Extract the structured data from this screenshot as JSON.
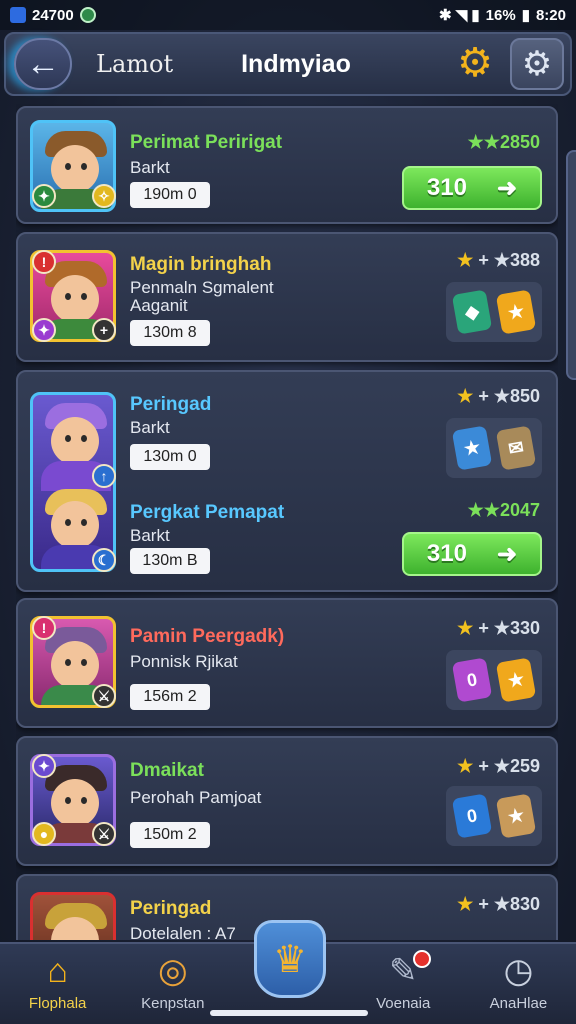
{
  "status": {
    "time_left": "24700",
    "right": "16%",
    "clock": "8:20"
  },
  "header": {
    "left_label": "Lamot",
    "title": "Indmyiao"
  },
  "cards": [
    {
      "name": "Perimat Peririgat",
      "name_color": "#7be05a",
      "sub1": "Barkt",
      "sub2": "",
      "timer": "190m 0",
      "stars": "★★2850",
      "action": "310"
    },
    {
      "name": "Magin bringhah",
      "name_color": "#f3d24a",
      "sub1": "Penmaln Sgmalent",
      "sub2": "Aaganit",
      "timer": "130m 8",
      "stars": "+ ★388"
    },
    {
      "name": "Peringad",
      "name_color": "#58c8ff",
      "sub1": "Barkt",
      "sub2": "",
      "timer": "130m 0",
      "stars": "+ ★850"
    },
    {
      "name": "Pergkat Pemapat",
      "name_color": "#58c8ff",
      "sub1": "Barkt",
      "sub2": "",
      "timer": "130m B",
      "stars": "★★2047",
      "action": "310"
    },
    {
      "name": "Pamin Peergadk)",
      "name_color": "#ff6a5c",
      "sub1": "Ponnisk Rjikat",
      "sub2": "",
      "timer": "156m 2",
      "stars": "+ ★330"
    },
    {
      "name": "Dmaikat",
      "name_color": "#7be05a",
      "sub1": "Perohah Pamjoat",
      "sub2": "",
      "timer": "150m 2",
      "stars": "+ ★259"
    },
    {
      "name": "Peringad",
      "name_color": "#f3d24a",
      "sub1": "Dotelalen : A7",
      "sub2": "",
      "timer": "",
      "stars": "+ ★830"
    }
  ],
  "nav": [
    {
      "label": "Flophala",
      "icon": "home-icon"
    },
    {
      "label": "Kenpstan",
      "icon": "spiral-icon"
    },
    {
      "label": "Voenaia",
      "icon": "map-icon"
    },
    {
      "label": "AnaHlae",
      "icon": "clock-icon"
    }
  ],
  "icons": {
    "back": "←",
    "gear": "⚙",
    "home": "⌂",
    "spiral": "◎",
    "map": "✎",
    "clock": "◷",
    "crown": "♛"
  }
}
